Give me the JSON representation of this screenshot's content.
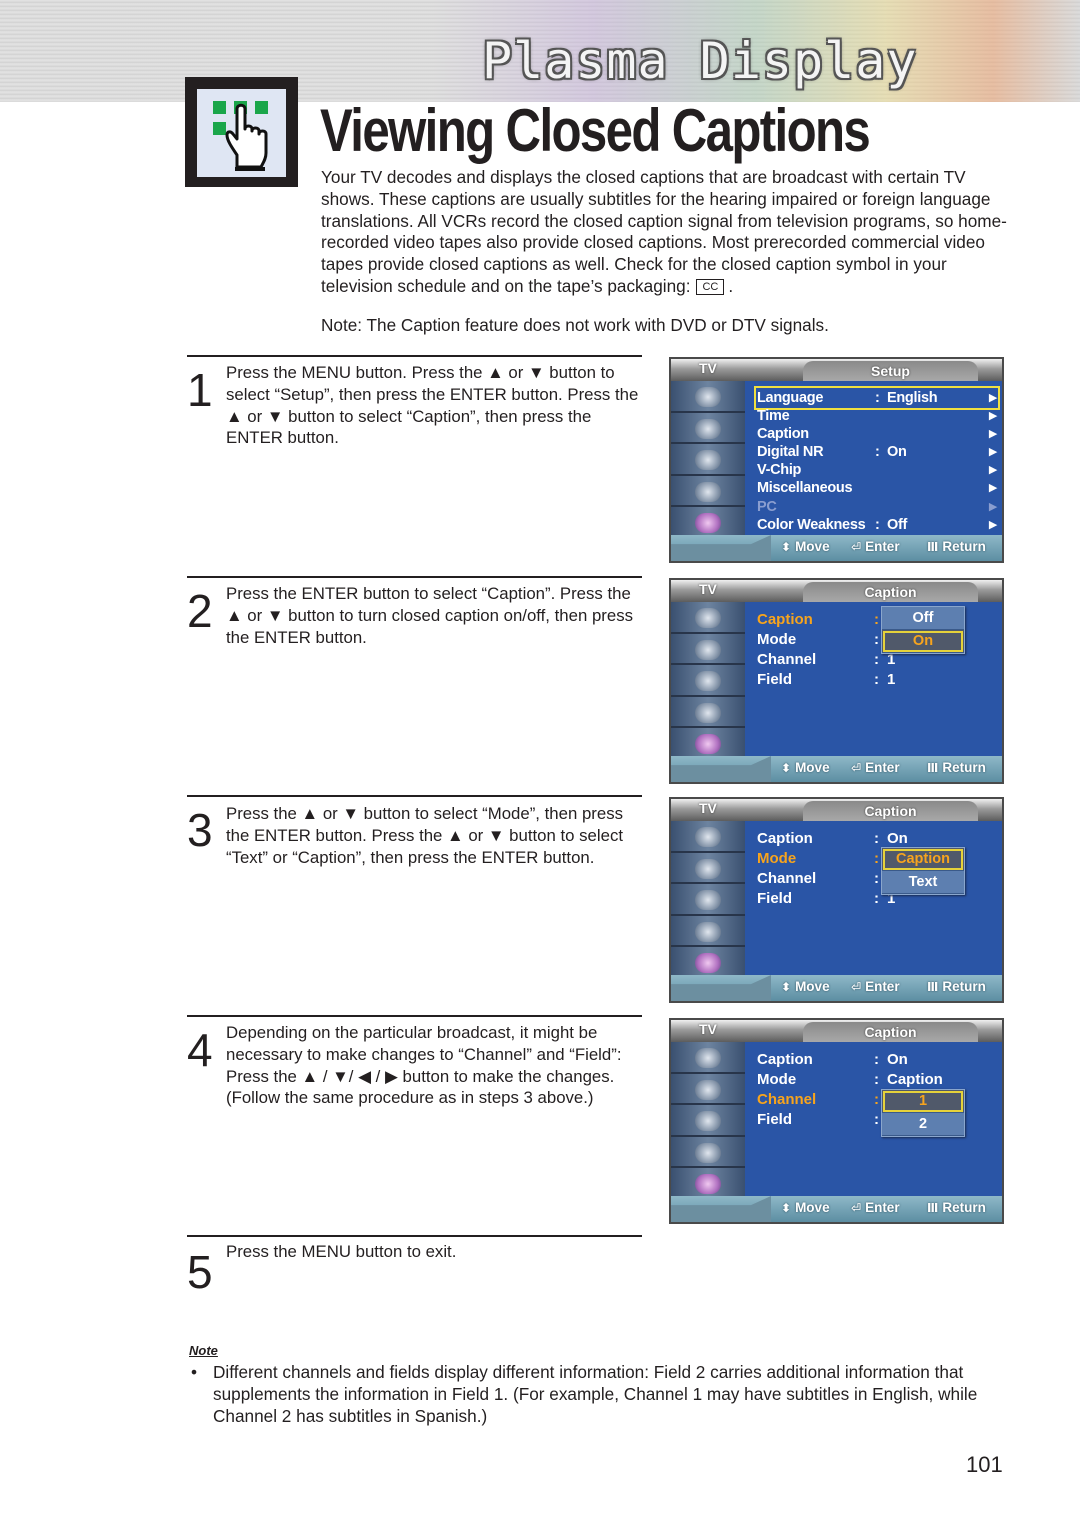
{
  "header": {
    "banner_title": "Plasma Display",
    "page_title": "Viewing Closed Captions"
  },
  "intro": {
    "paragraph": "Your TV decodes and displays the closed captions that are broadcast with certain TV shows. These captions are usually subtitles for the hearing impaired or foreign language translations. All VCRs record the closed caption signal from television programs, so home-recorded video tapes also provide closed captions. Most prerecorded commercial video tapes provide closed captions as well. Check for the closed caption symbol in your television schedule and on the tape’s packaging:",
    "cc_symbol": "CC",
    "trailing": ".",
    "note": "Note: The Caption feature does not work with DVD or DTV signals."
  },
  "steps": [
    {
      "number": "1",
      "text": "Press the MENU button. Press the ▲ or ▼  button to select “Setup”, then press the ENTER button. Press the ▲ or ▼ button to select “Caption”, then press the ENTER button."
    },
    {
      "number": "2",
      "text": "Press the ENTER button to select “Caption”. Press the ▲ or ▼ button to turn closed caption on/off, then press the ENTER button."
    },
    {
      "number": "3",
      "text": "Press the ▲ or ▼ button to select “Mode”, then press the ENTER button. Press the ▲ or ▼ button to select “Text” or “Caption”, then press the ENTER button."
    },
    {
      "number": "4",
      "text": "Depending on the particular broadcast, it might be necessary to make changes to “Channel” and “Field”: Press the ▲ / ▼/ ◀ / ▶ button to make the changes. (Follow the same procedure as in steps 3 above.)"
    },
    {
      "number": "5",
      "text": "Press the MENU button to exit."
    }
  ],
  "osd_common": {
    "tv_label": "TV",
    "hint_move": "Move",
    "hint_enter": "Enter",
    "hint_return": "Return",
    "move_glyph": "⬍",
    "enter_glyph": "⏎",
    "return_glyph": "Ⅲ",
    "arrow_glyph": "▶",
    "colon": ":"
  },
  "screens": [
    {
      "title": "Setup",
      "rows": [
        {
          "label": "Language",
          "value": "English",
          "arrow": true,
          "selected": true
        },
        {
          "label": "Time",
          "value": "",
          "arrow": true
        },
        {
          "label": "Caption",
          "value": "",
          "arrow": true
        },
        {
          "label": "Digital NR",
          "value": "On",
          "arrow": true
        },
        {
          "label": "V-Chip",
          "value": "",
          "arrow": true
        },
        {
          "label": "Miscellaneous",
          "value": "",
          "arrow": true
        },
        {
          "label": "PC",
          "value": "",
          "arrow": true,
          "disabled": true
        },
        {
          "label": "Color Weakness",
          "value": "Off",
          "arrow": true
        }
      ]
    },
    {
      "title": "Caption",
      "rows": [
        {
          "label": "Caption",
          "value": "",
          "active": true
        },
        {
          "label": "Mode",
          "value": ""
        },
        {
          "label": "Channel",
          "value": "1"
        },
        {
          "label": "Field",
          "value": "1"
        }
      ],
      "popup": {
        "options": [
          "Off",
          "On"
        ],
        "highlighted": "On"
      }
    },
    {
      "title": "Caption",
      "rows": [
        {
          "label": "Caption",
          "value": "On"
        },
        {
          "label": "Mode",
          "value": "",
          "active": true
        },
        {
          "label": "Channel",
          "value": ""
        },
        {
          "label": "Field",
          "value": "1"
        }
      ],
      "popup": {
        "options": [
          "Caption",
          "Text"
        ],
        "highlighted": "Caption"
      }
    },
    {
      "title": "Caption",
      "rows": [
        {
          "label": "Caption",
          "value": "On"
        },
        {
          "label": "Mode",
          "value": "Caption"
        },
        {
          "label": "Channel",
          "value": "",
          "active": true
        },
        {
          "label": "Field",
          "value": ""
        }
      ],
      "popup": {
        "options": [
          "1",
          "2"
        ],
        "highlighted": "1"
      }
    }
  ],
  "note": {
    "label": "Note",
    "bullet": "•",
    "text": "Different channels and fields display different information: Field 2 carries additional information that supplements the information in Field 1. (For example, Channel 1 may have subtitles in English, while Channel 2 has subtitles in Spanish.)"
  },
  "page_number": "101",
  "colors": {
    "osd_background": "#2a55a6",
    "osd_highlight_text": "#f7a41d",
    "osd_selection_border": "#f0e040",
    "icon_green": "#1aa64a"
  }
}
